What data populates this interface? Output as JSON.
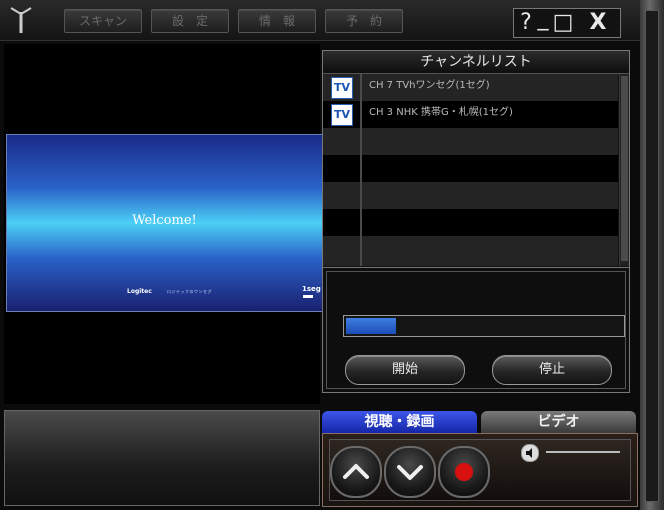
{
  "toolbar": {
    "scan_label": "スキャン",
    "settings_label": "設　定",
    "info_label": "情　報",
    "reserve_label": "予　約"
  },
  "window_controls": {
    "help": "?",
    "minimize": "_",
    "maximize": "□",
    "close": "X"
  },
  "video": {
    "welcome_text": "Welcome!",
    "brand": "Logitec",
    "brand_sub": "ロジテックのワンセグ",
    "seg_label": "1seg"
  },
  "channel_list": {
    "title": "チャンネルリスト",
    "items": [
      {
        "icon": "TV",
        "label": "CH 7  TVhワンセグ(1セグ)"
      },
      {
        "icon": "TV",
        "label": "CH 3  NHK 携帯G・札幌(1セグ)"
      }
    ]
  },
  "scan": {
    "progress_fraction": 0.18,
    "start_label": "開始",
    "stop_label": "停止"
  },
  "tabs": {
    "watch_record": "視聴・録画",
    "video": "ビデオ"
  },
  "colors": {
    "accent_blue": "#1c4db8",
    "record_red": "#d81010"
  }
}
